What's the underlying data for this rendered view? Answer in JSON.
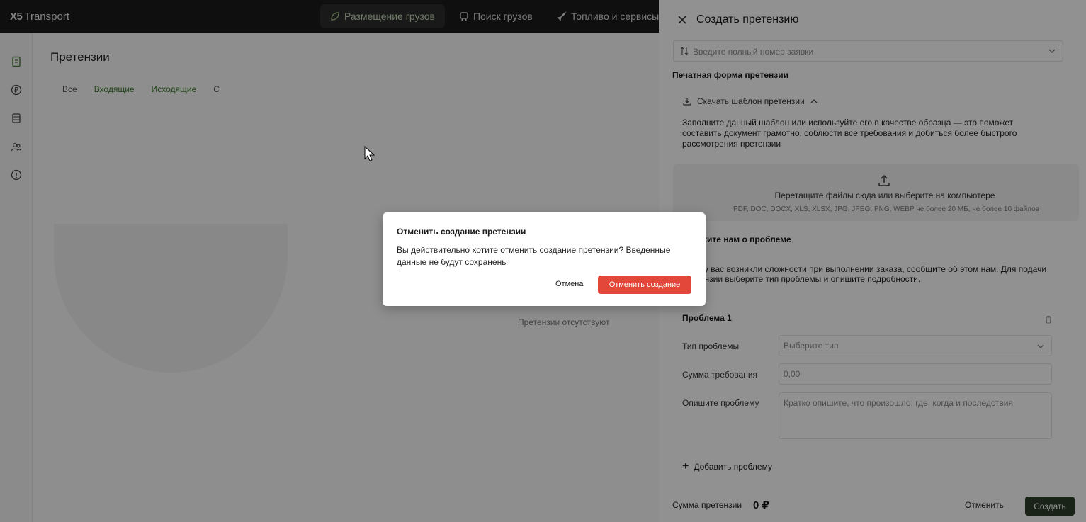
{
  "app": {
    "logo_mark": "X5",
    "logo_text": "Transport"
  },
  "nav": {
    "items": [
      {
        "label": "Размещение грузов",
        "icon": "leaf-icon",
        "active": true
      },
      {
        "label": "Поиск грузов",
        "icon": "truck-icon",
        "active": false
      },
      {
        "label": "Топливо и сервисы",
        "icon": "rocket-icon",
        "active": false
      }
    ]
  },
  "sidebar": {
    "icons": [
      "document-icon",
      "ruble-icon",
      "database-icon",
      "users-icon",
      "info-icon"
    ]
  },
  "main": {
    "title": "Претензии",
    "tabs": [
      "Все",
      "Входящие",
      "Исходящие",
      "С"
    ],
    "empty_text": "Претензии отсутствуют"
  },
  "drawer": {
    "title": "Создать претензию",
    "order_placeholder": "Введите полный номер заявки",
    "print_form_title": "Печатная форма претензии",
    "download_label": "Скачать шаблон претензии",
    "hint": "Заполните данный шаблон или используйте его в качестве образца — это поможет составить документ грамотно, соблюсти все требования и добиться более быстрого рассмотрения претензии",
    "dropzone_main": "Перетащите файлы сюда или выберите на компьютере",
    "dropzone_sub": "PDF, DOC, DOCX, XLS, XLSX, JPG, JPEG, PNG, WEBP не более 20 МБ, не более 10 файлов",
    "problem_section_title": "Расскажите нам о проблеме",
    "problem_intro": "Если у вас возникли сложности при выполнении заказа, сообщите об этом нам. Для подачи претензии выберите тип проблемы и опишите подробности.",
    "problem": {
      "title": "Проблема 1",
      "type_label": "Тип проблемы",
      "type_placeholder": "Выберите тип",
      "amount_label": "Сумма требования",
      "amount_value": "0,00",
      "describe_label": "Опишите проблему",
      "describe_placeholder": "Кратко опишите, что произошло: где, когда и последствия"
    },
    "add_problem": "Добавить проблему",
    "sum_label": "Сумма претензии",
    "sum_value": "0 ₽",
    "cancel_label": "Отменить",
    "create_label": "Создать"
  },
  "modal": {
    "title": "Отменить создание претензии",
    "text": "Вы действительно хотите отменить создание претензии? Введенные данные не будут сохранены",
    "cancel_label": "Отмена",
    "confirm_label": "Отменить создание"
  },
  "colors": {
    "accent_green": "#2f3e2a",
    "danger": "#e2473a",
    "overlay": "rgba(0,0,0,0.43)"
  }
}
